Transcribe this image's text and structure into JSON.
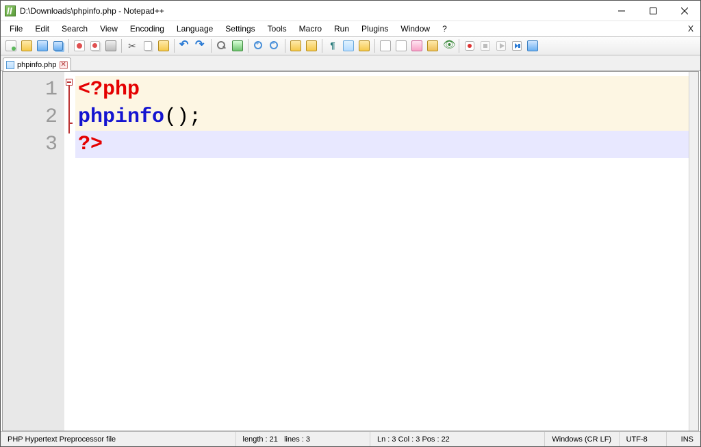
{
  "window": {
    "title": "D:\\Downloads\\phpinfo.php - Notepad++"
  },
  "menu": {
    "items": [
      "File",
      "Edit",
      "Search",
      "View",
      "Encoding",
      "Language",
      "Settings",
      "Tools",
      "Macro",
      "Run",
      "Plugins",
      "Window",
      "?"
    ],
    "close_doc_x": "X"
  },
  "tabs": [
    {
      "label": "phpinfo.php"
    }
  ],
  "code": {
    "line_numbers": [
      "1",
      "2",
      "3"
    ],
    "line1_tag": "<?php",
    "line2_func": "phpinfo",
    "line2_paren": "()",
    "line2_semi": ";",
    "line3_tag": "?>"
  },
  "status": {
    "filetype": "PHP Hypertext Preprocessor file",
    "length_label": "length : 21",
    "lines_label": "lines : 3",
    "caret": "Ln : 3    Col : 3    Pos : 22",
    "eol": "Windows (CR LF)",
    "encoding": "UTF-8",
    "mode": "INS"
  }
}
